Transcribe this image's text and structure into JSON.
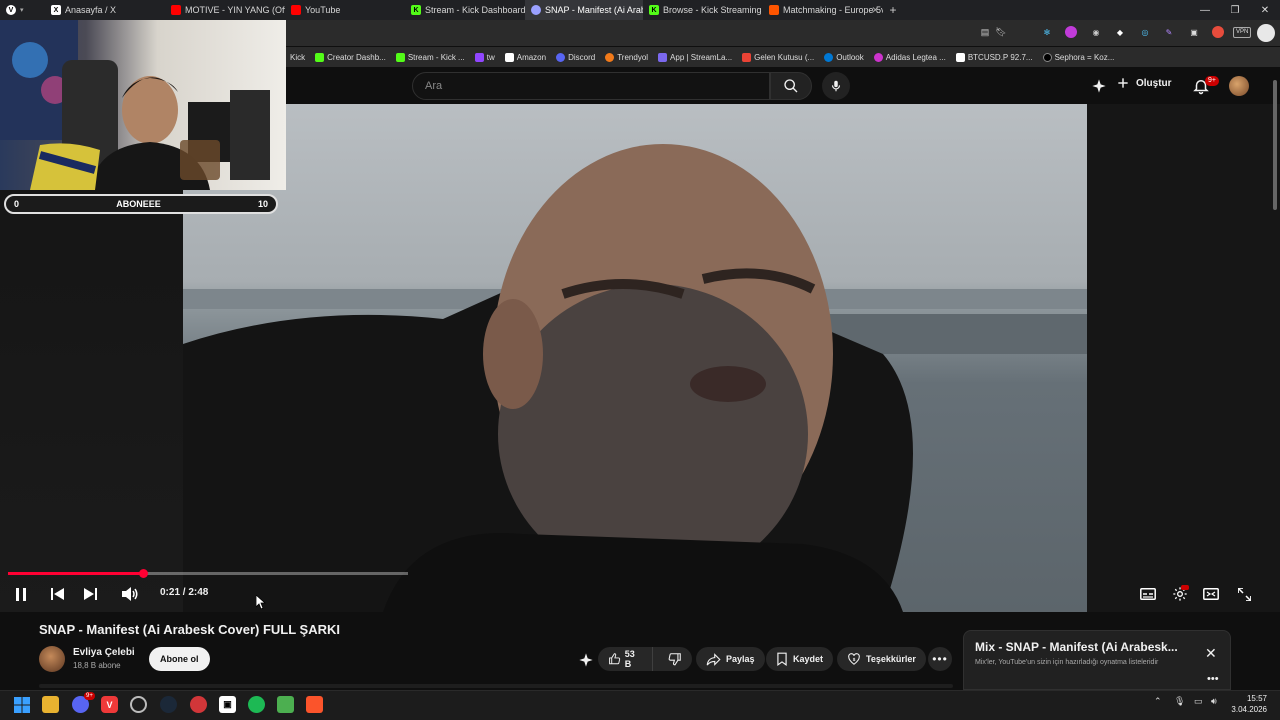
{
  "browser": {
    "tabs": [
      {
        "label": "Anasayfa / X",
        "icon": "x-icon",
        "color": "#ffffff",
        "active": false
      },
      {
        "label": "MOTIVE - YIN YANG (Offici",
        "icon": "youtube-icon",
        "color": "#ff0000",
        "active": false
      },
      {
        "label": "YouTube",
        "icon": "youtube-icon",
        "color": "#ff0000",
        "active": false
      },
      {
        "label": "Stream - Kick Dashboard",
        "icon": "kick-icon",
        "color": "#53fc18",
        "active": false
      },
      {
        "label": "SNAP - Manifest (Ai Arabe",
        "icon": "audio-icon",
        "color": "#9aa0ff",
        "active": true
      },
      {
        "label": "Browse - Kick Streaming",
        "icon": "kick-icon",
        "color": "#53fc18",
        "active": false
      },
      {
        "label": "Matchmaking - Europe 5v5",
        "icon": "faceit-icon",
        "color": "#ff5500",
        "active": false
      }
    ],
    "new_tab": "+",
    "bookmarks": [
      {
        "label": "Kick",
        "color": ""
      },
      {
        "label": "Creator Dashb...",
        "color": "#53fc18"
      },
      {
        "label": "Stream - Kick ...",
        "color": "#53fc18"
      },
      {
        "label": "tw",
        "color": "#9146ff"
      },
      {
        "label": "Amazon",
        "color": "#ffffff"
      },
      {
        "label": "Discord",
        "color": "#5865f2"
      },
      {
        "label": "Trendyol",
        "color": "#f27a1a"
      },
      {
        "label": "App | StreamLa...",
        "color": "#7b68ee"
      },
      {
        "label": "Gelen Kutusu (...",
        "color": "#ea4335"
      },
      {
        "label": "Outlook",
        "color": "#0078d4"
      },
      {
        "label": "Adidas Legtea ...",
        "color": "#cc33cc"
      },
      {
        "label": "BTCUSD.P 92.7...",
        "color": "#ffffff"
      },
      {
        "label": "Sephora = Koz...",
        "color": "#000000"
      }
    ],
    "vpn_label": "VPN"
  },
  "youtube": {
    "search_placeholder": "Ara",
    "create_label": "Oluştur",
    "notifications_badge": "9+"
  },
  "webcam": {
    "sub_goal_start": "0",
    "sub_goal_label": "ABONEEE",
    "sub_goal_end": "10"
  },
  "player": {
    "current_time": "0:21",
    "duration": "2:48",
    "time_display": "0:21 / 2:48",
    "progress_fraction": 0.125
  },
  "video": {
    "title": "SNAP - Manifest (Ai Arabesk Cover) FULL ŞARKI",
    "channel_name": "Evliya Çelebi",
    "channel_subs": "18,8 B abone",
    "subscribe_label": "Abone ol",
    "like_count": "53 B",
    "share_label": "Paylaş",
    "save_label": "Kaydet",
    "thanks_label": "Teşekkürler"
  },
  "mix": {
    "title": "Mix - SNAP - Manifest (Ai Arabesk...",
    "subtitle": "Mix'ler, YouTube'un sizin için hazırladığı oynatma listeleridir"
  },
  "taskbar": {
    "time": "15:57",
    "date": "3.04.2026",
    "discord_badge": "9+"
  }
}
